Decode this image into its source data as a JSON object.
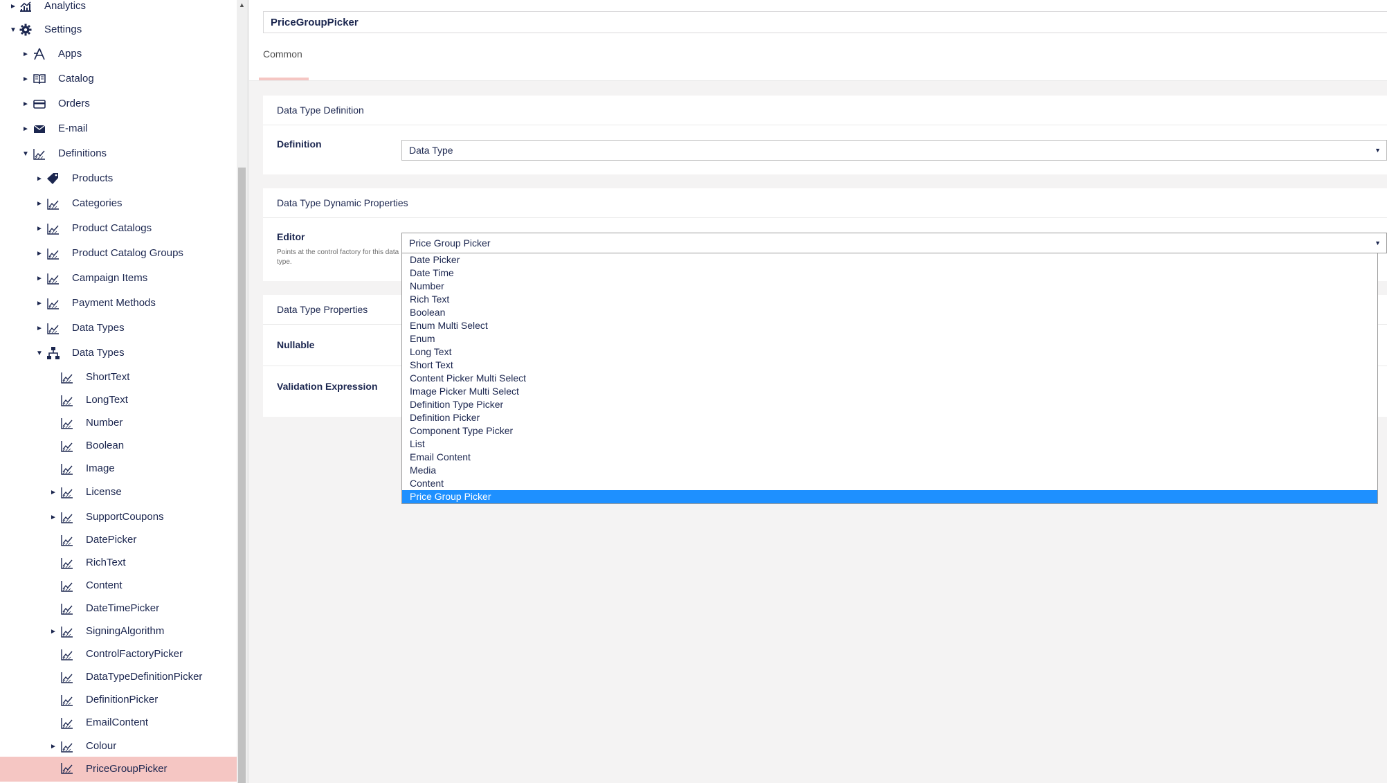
{
  "sidebar": {
    "items": [
      {
        "label": "Analytics",
        "icon": "analytics-icon",
        "toggle": "►",
        "level": 0
      },
      {
        "label": "Settings",
        "icon": "gear-icon",
        "toggle": "▼",
        "level": 0
      },
      {
        "label": "Apps",
        "icon": "apps-icon",
        "toggle": "►",
        "level": 1
      },
      {
        "label": "Catalog",
        "icon": "book-icon",
        "toggle": "►",
        "level": 1
      },
      {
        "label": "Orders",
        "icon": "credit-card-icon",
        "toggle": "►",
        "level": 1
      },
      {
        "label": "E-mail",
        "icon": "envelope-icon",
        "toggle": "►",
        "level": 1
      },
      {
        "label": "Definitions",
        "icon": "chart-line-icon",
        "toggle": "▼",
        "level": 1
      },
      {
        "label": "Products",
        "icon": "tag-icon",
        "toggle": "►",
        "level": 2
      },
      {
        "label": "Categories",
        "icon": "chart-line-icon",
        "toggle": "►",
        "level": 2
      },
      {
        "label": "Product Catalogs",
        "icon": "chart-line-icon",
        "toggle": "►",
        "level": 2
      },
      {
        "label": "Product Catalog Groups",
        "icon": "chart-line-icon",
        "toggle": "►",
        "level": 2
      },
      {
        "label": "Campaign Items",
        "icon": "chart-line-icon",
        "toggle": "►",
        "level": 2
      },
      {
        "label": "Payment Methods",
        "icon": "chart-line-icon",
        "toggle": "►",
        "level": 2
      },
      {
        "label": "Data Types",
        "icon": "chart-line-icon",
        "toggle": "►",
        "level": 2
      },
      {
        "label": "Data Types",
        "icon": "sitemap-icon",
        "toggle": "▼",
        "level": 2
      },
      {
        "label": "ShortText",
        "icon": "chart-line-icon",
        "toggle": "",
        "level": 3
      },
      {
        "label": "LongText",
        "icon": "chart-line-icon",
        "toggle": "",
        "level": 3
      },
      {
        "label": "Number",
        "icon": "chart-line-icon",
        "toggle": "",
        "level": 3
      },
      {
        "label": "Boolean",
        "icon": "chart-line-icon",
        "toggle": "",
        "level": 3
      },
      {
        "label": "Image",
        "icon": "chart-line-icon",
        "toggle": "",
        "level": 3
      },
      {
        "label": "License",
        "icon": "chart-line-icon",
        "toggle": "►",
        "level": 3
      },
      {
        "label": "SupportCoupons",
        "icon": "chart-line-icon",
        "toggle": "►",
        "level": 3
      },
      {
        "label": "DatePicker",
        "icon": "chart-line-icon",
        "toggle": "",
        "level": 3
      },
      {
        "label": "RichText",
        "icon": "chart-line-icon",
        "toggle": "",
        "level": 3
      },
      {
        "label": "Content",
        "icon": "chart-line-icon",
        "toggle": "",
        "level": 3
      },
      {
        "label": "DateTimePicker",
        "icon": "chart-line-icon",
        "toggle": "",
        "level": 3
      },
      {
        "label": "SigningAlgorithm",
        "icon": "chart-line-icon",
        "toggle": "►",
        "level": 3
      },
      {
        "label": "ControlFactoryPicker",
        "icon": "chart-line-icon",
        "toggle": "",
        "level": 3
      },
      {
        "label": "DataTypeDefinitionPicker",
        "icon": "chart-line-icon",
        "toggle": "",
        "level": 3
      },
      {
        "label": "DefinitionPicker",
        "icon": "chart-line-icon",
        "toggle": "",
        "level": 3
      },
      {
        "label": "EmailContent",
        "icon": "chart-line-icon",
        "toggle": "",
        "level": 3
      },
      {
        "label": "Colour",
        "icon": "chart-line-icon",
        "toggle": "►",
        "level": 3
      },
      {
        "label": "PriceGroupPicker",
        "icon": "chart-line-icon",
        "toggle": "",
        "level": 3,
        "active": true
      }
    ]
  },
  "header": {
    "name_value": "PriceGroupPicker",
    "tabs": [
      {
        "label": "Common"
      }
    ]
  },
  "definition_panel": {
    "title": "Data Type Definition",
    "definition_label": "Definition",
    "definition_value": "Data Type"
  },
  "dynamic_panel": {
    "title": "Data Type Dynamic Properties",
    "editor_label": "Editor",
    "editor_desc": "Points at the control factory for this data type.",
    "editor_value": "Price Group Picker",
    "options": [
      "Date Picker",
      "Date Time",
      "Number",
      "Rich Text",
      "Boolean",
      "Enum Multi Select",
      "Enum",
      "Long Text",
      "Short Text",
      "Content Picker Multi Select",
      "Image Picker Multi Select",
      "Definition Type Picker",
      "Definition Picker",
      "Component Type Picker",
      "List",
      "Email Content",
      "Media",
      "Content",
      "Price Group Picker"
    ],
    "selected_option": "Price Group Picker"
  },
  "properties_panel": {
    "title": "Data Type Properties",
    "nullable_label": "Nullable",
    "validation_label": "Validation Expression"
  },
  "colors": {
    "accent": "#f5c6c3",
    "text_navy": "#1b264f",
    "selection_blue": "#1e90ff"
  }
}
